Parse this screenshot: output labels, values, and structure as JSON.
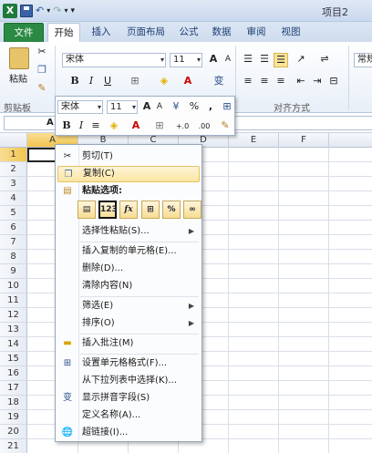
{
  "window": {
    "title": "项目2"
  },
  "qat": {
    "logo": "X",
    "undo": "↶",
    "redo": "↷",
    "more": "▾"
  },
  "tabs": [
    "文件",
    "开始",
    "插入",
    "页面布局",
    "公式",
    "数据",
    "审阅",
    "视图"
  ],
  "ribbon": {
    "paste_label": "粘贴",
    "clipboard_label": "剪贴板",
    "font_name": "宋体",
    "font_size": "11",
    "grow_font": "A",
    "shrink_font": "A",
    "bold": "B",
    "italic": "I",
    "underline": "U",
    "alignment_label": "对齐方式",
    "number_format": "常规"
  },
  "formula_bar": {
    "name_box": "A1"
  },
  "columns": [
    "A",
    "B",
    "C",
    "D",
    "E",
    "F"
  ],
  "rows": [
    "1",
    "2",
    "3",
    "4",
    "5",
    "6",
    "7",
    "8",
    "9",
    "10",
    "11",
    "12",
    "13",
    "14",
    "15",
    "16",
    "17",
    "18",
    "19",
    "20",
    "21"
  ],
  "mini_toolbar": {
    "font_name": "宋体",
    "font_size": "11",
    "bold": "B",
    "italic": "I",
    "percent": "%",
    "comma": ",",
    "inc_decimal": "+.0",
    "dec_decimal": ".00"
  },
  "context_menu": {
    "cut": "剪切(T)",
    "copy": "复制(C)",
    "paste_options": "粘贴选项:",
    "paste_icons": [
      "",
      "123",
      "fx",
      "",
      "%",
      ""
    ],
    "paste_special": "选择性粘贴(S)...",
    "insert_copied": "插入复制的单元格(E)...",
    "delete": "删除(D)...",
    "clear": "清除内容(N)",
    "filter": "筛选(E)",
    "sort": "排序(O)",
    "insert_comment": "插入批注(M)",
    "format_cells": "设置单元格格式(F)...",
    "pick_list": "从下拉列表中选择(K)...",
    "phonetic": "显示拼音字段(S)",
    "define_name": "定义名称(A)...",
    "hyperlink": "超链接(I)..."
  }
}
